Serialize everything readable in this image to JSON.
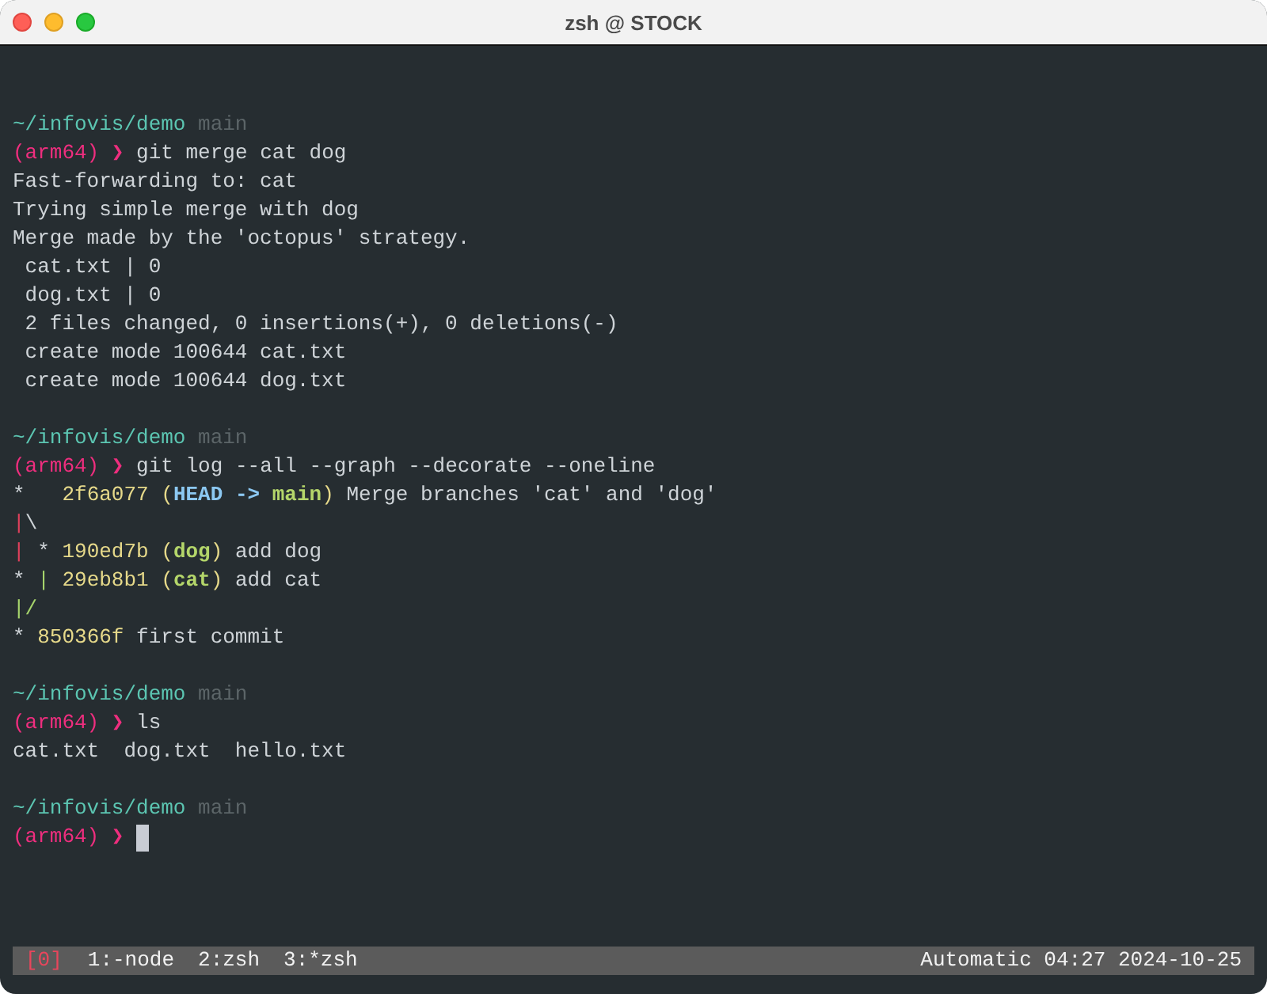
{
  "window": {
    "title": "zsh @ STOCK"
  },
  "blocks": [
    {
      "path": "~/infovis/demo",
      "branch": "main",
      "env": "(arm64)",
      "prompt_symbol": "❯",
      "command": "git merge cat dog",
      "cursor": false,
      "output": [
        [
          {
            "text": "Fast-forwarding to: cat",
            "kind": "plain"
          }
        ],
        [
          {
            "text": "Trying simple merge with dog",
            "kind": "plain"
          }
        ],
        [
          {
            "text": "Merge made by the 'octopus' strategy.",
            "kind": "plain"
          }
        ],
        [
          {
            "text": " cat.txt | 0",
            "kind": "plain"
          }
        ],
        [
          {
            "text": " dog.txt | 0",
            "kind": "plain"
          }
        ],
        [
          {
            "text": " 2 files changed, 0 insertions(+), 0 deletions(-)",
            "kind": "plain"
          }
        ],
        [
          {
            "text": " create mode 100644 cat.txt",
            "kind": "plain"
          }
        ],
        [
          {
            "text": " create mode 100644 dog.txt",
            "kind": "plain"
          }
        ]
      ]
    },
    {
      "path": "~/infovis/demo",
      "branch": "main",
      "env": "(arm64)",
      "prompt_symbol": "❯",
      "command": "git log --all --graph --decorate --oneline",
      "cursor": false,
      "output": [
        [
          {
            "text": "*   ",
            "kind": "plain"
          },
          {
            "text": "2f6a077 (",
            "kind": "hash"
          },
          {
            "text": "HEAD -> ",
            "kind": "head"
          },
          {
            "text": "main",
            "kind": "ref"
          },
          {
            "text": ")",
            "kind": "hash"
          },
          {
            "text": " Merge branches 'cat' and 'dog'",
            "kind": "plain"
          }
        ],
        [
          {
            "text": "|",
            "kind": "graph_red"
          },
          {
            "text": "\\",
            "kind": "plain"
          }
        ],
        [
          {
            "text": "|",
            "kind": "graph_red"
          },
          {
            "text": " * ",
            "kind": "plain"
          },
          {
            "text": "190ed7b (",
            "kind": "hash"
          },
          {
            "text": "dog",
            "kind": "ref"
          },
          {
            "text": ")",
            "kind": "hash"
          },
          {
            "text": " add dog",
            "kind": "plain"
          }
        ],
        [
          {
            "text": "* ",
            "kind": "plain"
          },
          {
            "text": "|",
            "kind": "graph_green"
          },
          {
            "text": " 29eb8b1 (",
            "kind": "hash"
          },
          {
            "text": "cat",
            "kind": "ref"
          },
          {
            "text": ")",
            "kind": "hash"
          },
          {
            "text": " add cat",
            "kind": "plain"
          }
        ],
        [
          {
            "text": "|/",
            "kind": "graph_green"
          }
        ],
        [
          {
            "text": "* ",
            "kind": "plain"
          },
          {
            "text": "850366f",
            "kind": "hash"
          },
          {
            "text": " first commit",
            "kind": "plain"
          }
        ]
      ]
    },
    {
      "path": "~/infovis/demo",
      "branch": "main",
      "env": "(arm64)",
      "prompt_symbol": "❯",
      "command": "ls",
      "cursor": false,
      "output": [
        [
          {
            "text": "cat.txt  dog.txt  hello.txt",
            "kind": "plain"
          }
        ]
      ]
    },
    {
      "path": "~/infovis/demo",
      "branch": "main",
      "env": "(arm64)",
      "prompt_symbol": "❯",
      "cursor": true
    }
  ],
  "status_bar": {
    "session": "[0]",
    "windows": [
      "1:-node",
      "2:zsh",
      "3:*zsh"
    ],
    "right": "Automatic 04:27 2024-10-25"
  }
}
